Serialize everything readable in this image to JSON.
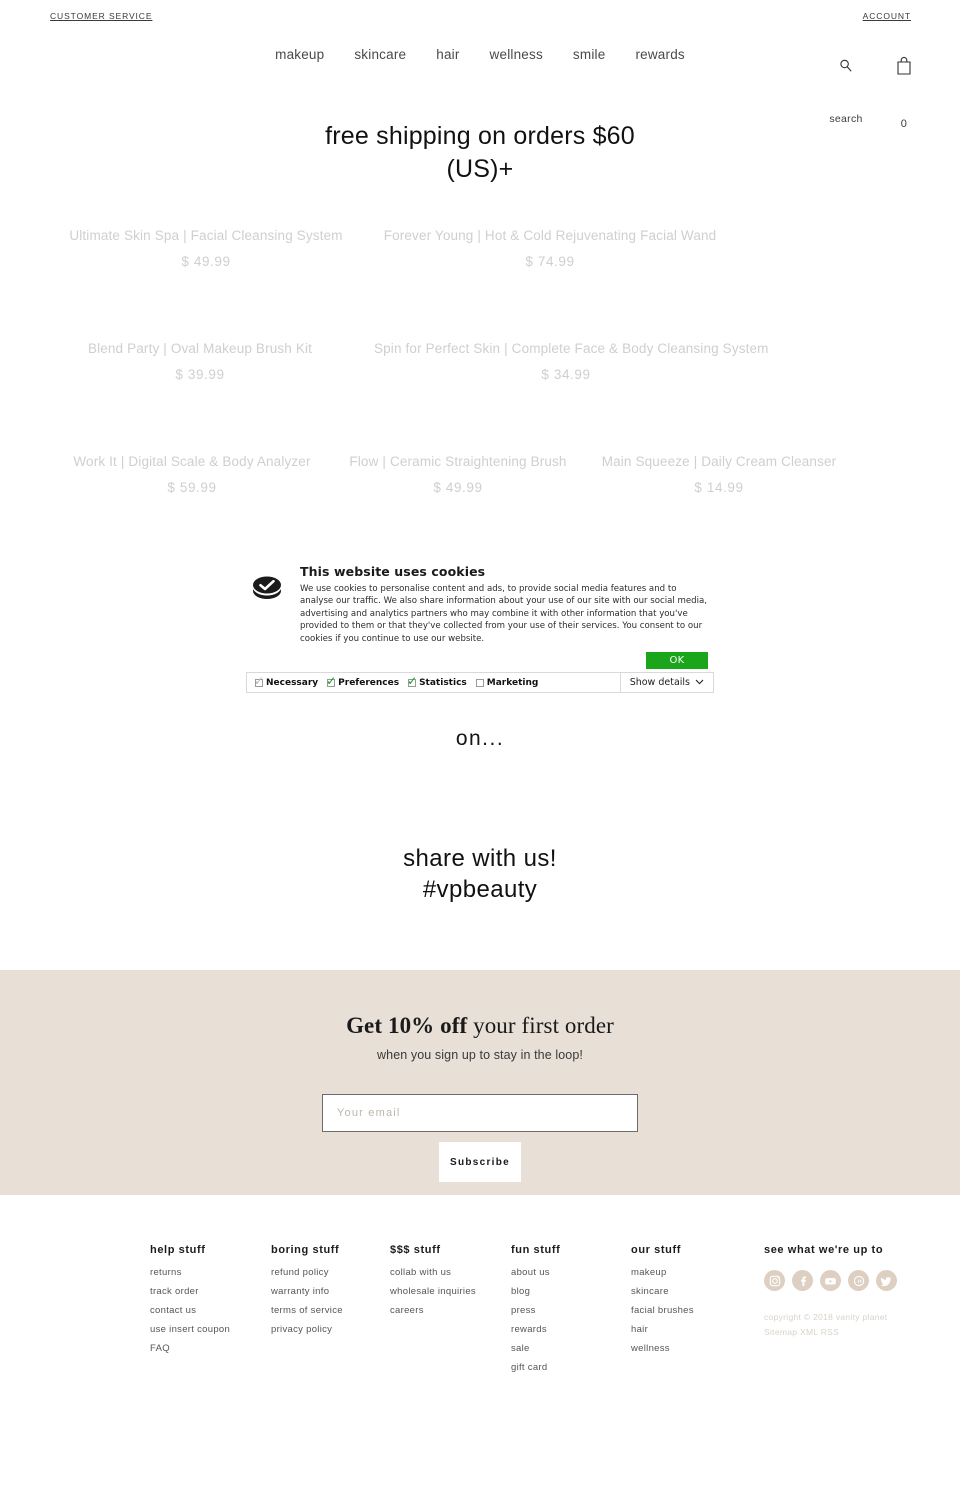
{
  "utility": {
    "customer_service": "CUSTOMER SERVICE",
    "account": "ACCOUNT"
  },
  "nav": {
    "items": [
      {
        "label": "makeup"
      },
      {
        "label": "skincare"
      },
      {
        "label": "hair"
      },
      {
        "label": "wellness"
      },
      {
        "label": "smile"
      },
      {
        "label": "rewards"
      }
    ]
  },
  "header_icons": {
    "search_icon": "search-icon",
    "search_label": "search",
    "cart_icon": "shopping-bag-icon",
    "cart_count": "0"
  },
  "hero": {
    "line1": "free shipping on orders $60",
    "line2": "(US)+"
  },
  "products": [
    {
      "title": "Ultimate Skin Spa | Facial Cleansing System",
      "price": "$ 49.99"
    },
    {
      "title": "Forever Young | Hot & Cold Rejuvenating Facial Wand",
      "price": "$ 74.99"
    },
    {
      "title": "Blend Party | Oval Makeup Brush Kit",
      "price": "$ 39.99"
    },
    {
      "title": "Spin for Perfect Skin | Complete Face & Body Cleansing System",
      "price": "$ 34.99"
    },
    {
      "title": "Work It | Digital Scale & Body Analyzer",
      "price": "$ 59.99"
    },
    {
      "title": "Flow | Ceramic Straightening Brush",
      "price": "$ 49.99"
    },
    {
      "title": "Main Squeeze | Daily Cream Cleanser",
      "price": "$ 14.99"
    }
  ],
  "cookie_banner": {
    "icon": "cookie-check-icon",
    "title": "This website uses cookies",
    "text": "We use cookies to personalise content and ads, to provide social media features and to analyse our traffic. We also share information about your use of our site with our social media, advertising and analytics partners who may combine it with other information that you've provided to them or that they've collected from your use of their services. You consent to our cookies if you continue to use our website.",
    "ok_label": "OK",
    "ok_color": "#1aa51a",
    "categories": [
      {
        "label": "Necessary",
        "state": "checked-gray"
      },
      {
        "label": "Preferences",
        "state": "checked-green"
      },
      {
        "label": "Statistics",
        "state": "checked-green"
      },
      {
        "label": "Marketing",
        "state": "unchecked"
      }
    ],
    "details_label": "Show details",
    "chevron": "⌄"
  },
  "mid": {
    "on_text": "on...",
    "share_line1": "share with us!",
    "share_line2": "#vpbeauty"
  },
  "newsletter": {
    "heading_bold": "Get 10% off",
    "heading_rest": " your first order",
    "subheading": "when you sign up to stay in the loop!",
    "email_placeholder": "Your email",
    "email_value": "",
    "subscribe_label": "Subscribe",
    "background": "#e8dfd7"
  },
  "footer": {
    "columns": [
      {
        "head": "help stuff",
        "links": [
          "returns",
          "track order",
          "contact us",
          "use insert coupon",
          "FAQ"
        ]
      },
      {
        "head": "boring stuff",
        "links": [
          "refund policy",
          "warranty info",
          "terms of service",
          "privacy policy"
        ]
      },
      {
        "head": "$$$ stuff",
        "links": [
          "collab with us",
          "wholesale inquiries",
          "careers"
        ]
      },
      {
        "head": "fun stuff",
        "links": [
          "about us",
          "blog",
          "press",
          "rewards",
          "sale",
          "gift card"
        ]
      },
      {
        "head": "our stuff",
        "links": [
          "makeup",
          "skincare",
          "facial brushes",
          "hair",
          "wellness"
        ]
      }
    ],
    "social": {
      "head": "see what we're up to",
      "icons": [
        "instagram-icon",
        "facebook-icon",
        "youtube-icon",
        "pinterest-icon",
        "twitter-icon"
      ],
      "color": "#ddd0c2"
    },
    "copyright_line": "copyright © 2018 vanity planet",
    "sitemap_label": "Sitemap",
    "xml_label": "XML",
    "rss_label": "RSS"
  }
}
